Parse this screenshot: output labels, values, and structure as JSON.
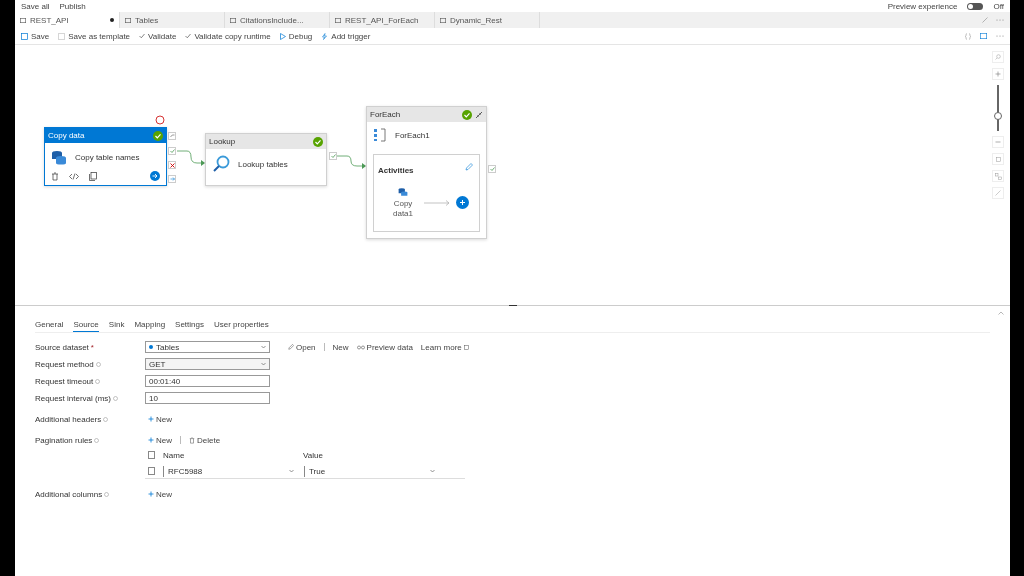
{
  "top_menu": [
    {
      "label": "Save all"
    },
    {
      "label": "Publish"
    }
  ],
  "preview": {
    "label": "Preview experience",
    "on": false,
    "state_label": "Off"
  },
  "tabs": [
    {
      "label": "REST_API",
      "selected": true,
      "unsaved": true
    },
    {
      "label": "Tables",
      "selected": false,
      "unsaved": false
    },
    {
      "label": "CitationsInclude...",
      "selected": false,
      "unsaved": false
    },
    {
      "label": "REST_API_ForEach",
      "selected": false,
      "unsaved": false
    },
    {
      "label": "Dynamic_Rest",
      "selected": false,
      "unsaved": false
    }
  ],
  "toolbar": [
    "Save",
    "Save as template",
    "Validate",
    "Validate copy runtime",
    "Debug",
    "Add trigger"
  ],
  "zoom": {
    "level": 0.3
  },
  "activities": [
    {
      "kind": "copy",
      "title": "Copy data",
      "name": "Copy table names",
      "selected": true
    },
    {
      "kind": "lookup",
      "title": "Lookup",
      "name": "Lookup tables",
      "selected": false
    },
    {
      "kind": "foreach",
      "title": "ForEach",
      "name": "ForEach1",
      "selected": false,
      "inner_title": "Activities",
      "inner_activity": "Copy data1"
    }
  ],
  "properties": {
    "tabs": [
      {
        "label": "General",
        "selected": false
      },
      {
        "label": "Source",
        "selected": true
      },
      {
        "label": "Sink",
        "selected": false
      },
      {
        "label": "Mapping",
        "selected": false
      },
      {
        "label": "Settings",
        "selected": false
      },
      {
        "label": "User properties",
        "selected": false
      }
    ],
    "fields": [
      {
        "kind": "dataset",
        "label": "Source dataset",
        "required_mark": "*",
        "info": false,
        "value": "Tables",
        "actions": [
          "Open",
          "New",
          "Preview data",
          "Learn more"
        ]
      },
      {
        "kind": "select",
        "label": "Request method",
        "info": true,
        "value": "GET"
      },
      {
        "kind": "text",
        "label": "Request timeout",
        "info": true,
        "value": "00:01:40"
      },
      {
        "kind": "text",
        "label": "Request interval (ms)",
        "info": true,
        "value": "10"
      },
      {
        "kind": "add",
        "label": "Additional headers",
        "info": true,
        "actions": [
          "New"
        ]
      },
      {
        "kind": "table",
        "label": "Pagination rules",
        "info": true,
        "actions": [
          "New",
          "Delete"
        ],
        "columns": [
          "Name",
          "Value"
        ],
        "select_all_checked": false,
        "rows": [
          {
            "name": "RFC5988",
            "value": "True",
            "checked": false
          }
        ]
      },
      {
        "kind": "add",
        "label": "Additional columns",
        "info": true,
        "actions": [
          "New"
        ]
      }
    ]
  }
}
